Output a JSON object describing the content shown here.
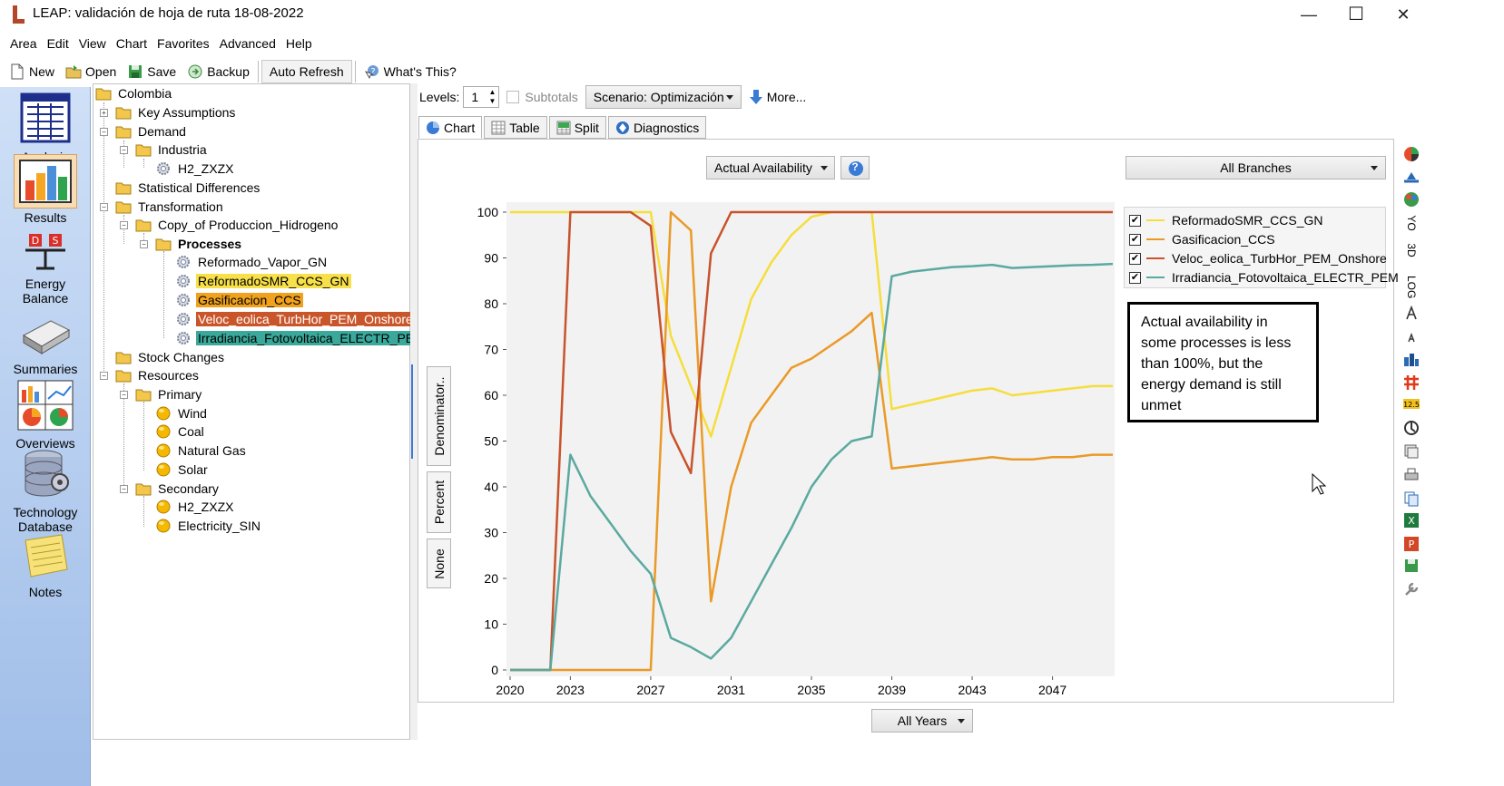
{
  "window": {
    "title": "LEAP: validación de hoja de ruta 18-08-2022",
    "controls": {
      "minimize": "—",
      "maximize": "☐",
      "close": "✕"
    }
  },
  "menu": [
    "Area",
    "Edit",
    "View",
    "Chart",
    "Favorites",
    "Advanced",
    "Help"
  ],
  "toolbar": {
    "new": "New",
    "open": "Open",
    "save": "Save",
    "backup": "Backup",
    "auto_refresh": "Auto Refresh",
    "whats_this": "What's This?"
  },
  "sidebar": {
    "analysis": "Analysis",
    "results": "Results",
    "energy_balance": [
      "Energy",
      "Balance"
    ],
    "summaries": "Summaries",
    "overviews": "Overviews",
    "technology_database": [
      "Technology",
      "Database"
    ],
    "notes": "Notes"
  },
  "tree": {
    "colombia": "Colombia",
    "key_assumptions": "Key Assumptions",
    "demand": "Demand",
    "industria": "Industria",
    "h2_zxzx_demand": "H2_ZXZX",
    "statistical_differences": "Statistical Differences",
    "transformation": "Transformation",
    "copy_of_produccion": "Copy_of Produccion_Hidrogeno",
    "processes": "Processes",
    "reformado_vapor": "Reformado_Vapor_GN",
    "reformado_smr": "ReformadoSMR_CCS_GN",
    "gasificacion": "Gasificacion_CCS",
    "veloc_eolica": "Veloc_eolica_TurbHor_PEM_Onshore",
    "irradiancia": "Irradiancia_Fotovoltaica_ELECTR_PEM",
    "stock_changes": "Stock Changes",
    "resources": "Resources",
    "primary": "Primary",
    "wind": "Wind",
    "coal": "Coal",
    "natural_gas": "Natural Gas",
    "solar": "Solar",
    "secondary": "Secondary",
    "h2_zxzx_res": "H2_ZXZX",
    "electricity_sin": "Electricity_SIN",
    "highlight_colors": {
      "reformado_smr": "#f7e04a",
      "gasificacion": "#f0a21e",
      "veloc_eolica": "#c9562a",
      "irradiancia": "#3aa89a"
    }
  },
  "controls": {
    "levels_label": "Levels:",
    "levels_value": "1",
    "subtotals_label": "Subtotals",
    "scenario": "Scenario: Optimización",
    "more": "More...",
    "variable": "Actual Availability",
    "help_icon": "?",
    "branches": "All Branches",
    "years": "All Years"
  },
  "tabs": {
    "chart": "Chart",
    "table": "Table",
    "split": "Split",
    "diagnostics": "Diagnostics"
  },
  "vertical_tabs": {
    "denominator": "Denominator..",
    "percent": "Percent",
    "none": "None"
  },
  "callout": "Actual availability in some processes is less than 100%, but the energy demand is still unmet",
  "right_tools": [
    "YO",
    "3D",
    "LOG"
  ],
  "chart_data": {
    "type": "line",
    "x": [
      2020,
      2021,
      2022,
      2023,
      2024,
      2025,
      2026,
      2027,
      2028,
      2029,
      2030,
      2031,
      2032,
      2033,
      2034,
      2035,
      2036,
      2037,
      2038,
      2039,
      2040,
      2041,
      2042,
      2043,
      2044,
      2045,
      2046,
      2047,
      2048,
      2049,
      2050
    ],
    "x_ticks": [
      2020,
      2023,
      2027,
      2031,
      2035,
      2039,
      2043,
      2047
    ],
    "ylim": [
      0,
      100
    ],
    "y_ticks": [
      0,
      10,
      20,
      30,
      40,
      50,
      60,
      70,
      80,
      90,
      100
    ],
    "legend_position": "right",
    "grid": false,
    "series": [
      {
        "name": "ReformadoSMR_CCS_GN",
        "color": "#f5de3c",
        "values": [
          100,
          100,
          100,
          100,
          100,
          100,
          100,
          100,
          73,
          62,
          51,
          66,
          81,
          89,
          95,
          99,
          100,
          100,
          100,
          57,
          58,
          59,
          60,
          61,
          61.5,
          60,
          60.5,
          61,
          61.5,
          62,
          62
        ]
      },
      {
        "name": "Gasificacion_CCS",
        "color": "#ea9a26",
        "values": [
          0,
          0,
          0,
          0,
          0,
          0,
          0,
          0,
          100,
          96,
          15,
          40,
          54,
          60,
          66,
          68,
          71,
          74,
          78,
          44,
          44.5,
          45,
          45.5,
          46,
          46.5,
          46,
          46,
          46.5,
          46.5,
          47,
          47
        ]
      },
      {
        "name": "Veloc_eolica_TurbHor_PEM_Onshore",
        "color": "#c8532c",
        "values": [
          0,
          0,
          0,
          100,
          100,
          100,
          100,
          97,
          52,
          43,
          91,
          100,
          100,
          100,
          100,
          100,
          100,
          100,
          100,
          100,
          100,
          100,
          100,
          100,
          100,
          100,
          100,
          100,
          100,
          100,
          100
        ]
      },
      {
        "name": "Irradiancia_Fotovoltaica_ELECTR_PEM",
        "color": "#5aa9a0",
        "values": [
          0,
          0,
          0,
          47,
          38,
          32,
          26,
          21,
          7,
          5,
          2.5,
          7,
          15,
          23,
          31,
          40,
          46,
          50,
          51,
          86,
          87,
          87.5,
          88,
          88.2,
          88.5,
          87.8,
          88,
          88.2,
          88.4,
          88.5,
          88.7
        ]
      }
    ]
  }
}
